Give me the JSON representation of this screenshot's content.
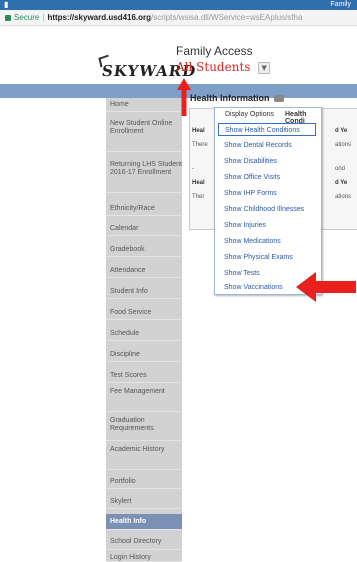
{
  "window": {
    "title": "Family"
  },
  "browser": {
    "secure_label": "Secure",
    "url_host": "https://skyward.usd416.org",
    "url_path": "/scripts/wsisa.dll/WService=wsEAplus/sfha"
  },
  "header": {
    "logo_text": "SKYWARD",
    "family_access": "Family Access",
    "all_students": "All Students",
    "student_dropdown_icon": "chevron-down-icon"
  },
  "sidebar": {
    "items": [
      {
        "label": "Home"
      },
      {
        "label": "New Student Online Enrollment"
      },
      {
        "label": "Returning LHS Student 2016-17 Enrollment"
      },
      {
        "label": "Ethnicity/Race"
      },
      {
        "label": "Calendar"
      },
      {
        "label": "Gradebook"
      },
      {
        "label": "Attendance"
      },
      {
        "label": "Student Info"
      },
      {
        "label": "Food Service"
      },
      {
        "label": "Schedule"
      },
      {
        "label": "Discipline"
      },
      {
        "label": "Test Scores"
      },
      {
        "label": "Fee Management"
      },
      {
        "label": "Graduation Requirements"
      },
      {
        "label": "Academic History"
      },
      {
        "label": "Portfolio"
      },
      {
        "label": "Skylert"
      },
      {
        "label": "Health Info"
      },
      {
        "label": "School Directory"
      },
      {
        "label": "Login History"
      }
    ],
    "active_label": "Health Info"
  },
  "content": {
    "title": "Health Information",
    "panel": {
      "header1": "Heal",
      "header1_right": "d Ye",
      "row1": "There",
      "row1_right": "ations",
      "row2": "-",
      "row2_right": "ond",
      "header2": "Heal",
      "header2_right": "d Ye",
      "row3": "Ther",
      "row3_right": "ations"
    }
  },
  "dropdown": {
    "title": "Display Options",
    "health_condi": "Health Condi",
    "options": [
      {
        "label": "Show Health Conditions"
      },
      {
        "label": "Show Dental Records"
      },
      {
        "label": "Show Disabilities"
      },
      {
        "label": "Show Office Visits"
      },
      {
        "label": "Show IHP Forms"
      },
      {
        "label": "Show Childhood Illnesses"
      },
      {
        "label": "Show Injuries"
      },
      {
        "label": "Show Medications"
      },
      {
        "label": "Show Physical Exams"
      },
      {
        "label": "Show Tests"
      },
      {
        "label": "Show Vaccinations"
      }
    ]
  },
  "colors": {
    "annotation_arrow": "#e8211e",
    "blue_bar": "#7ea0c8",
    "active_nav": "#7a90b4",
    "link_text": "#2b5aa8"
  }
}
